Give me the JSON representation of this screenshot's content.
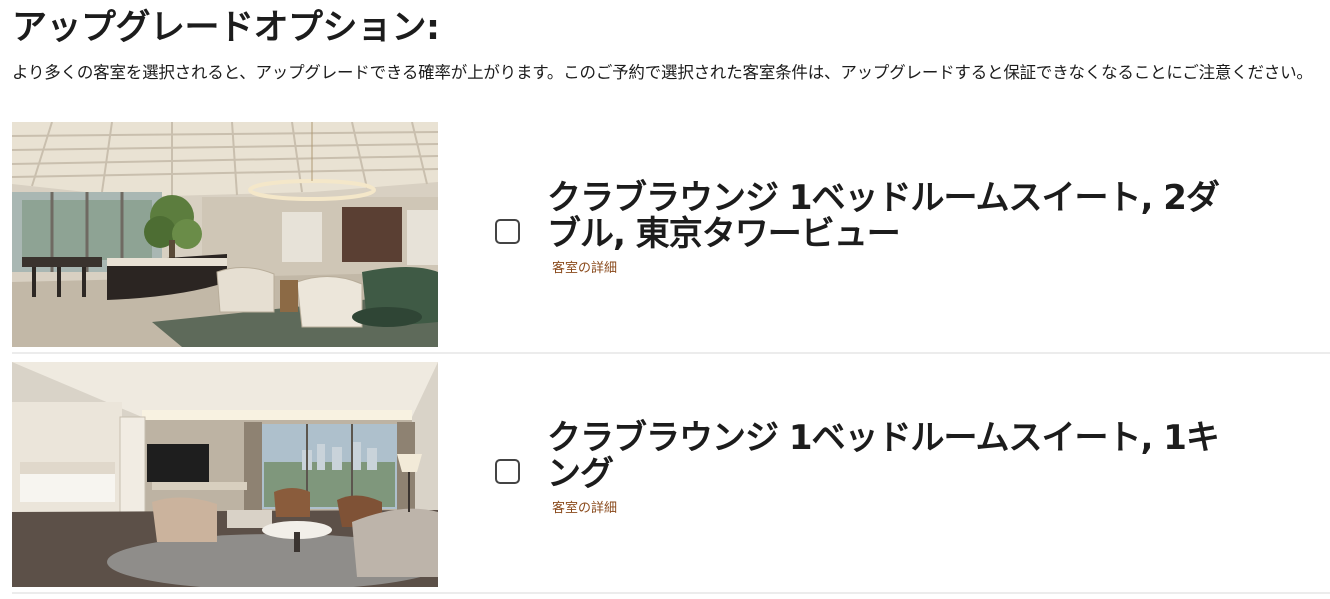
{
  "page": {
    "title": "アップグレードオプション:",
    "description": "より多くの客室を選択されると、アップグレードできる確率が上がります。このご予約で選択された客室条件は、アップグレードすると保証できなくなることにご注意ください。"
  },
  "rooms": [
    {
      "name": "クラブラウンジ 1ベッドルームスイート, 2ダブル, 東京タワービュー",
      "details_link": "客室の詳細",
      "checked": false
    },
    {
      "name": "クラブラウンジ 1ベッドルームスイート, 1キング",
      "details_link": "客室の詳細",
      "checked": false
    }
  ],
  "colors": {
    "text": "#1c1c1c",
    "link": "#8a4a1c",
    "separator": "#ececec",
    "checkbox_border": "#444444"
  }
}
